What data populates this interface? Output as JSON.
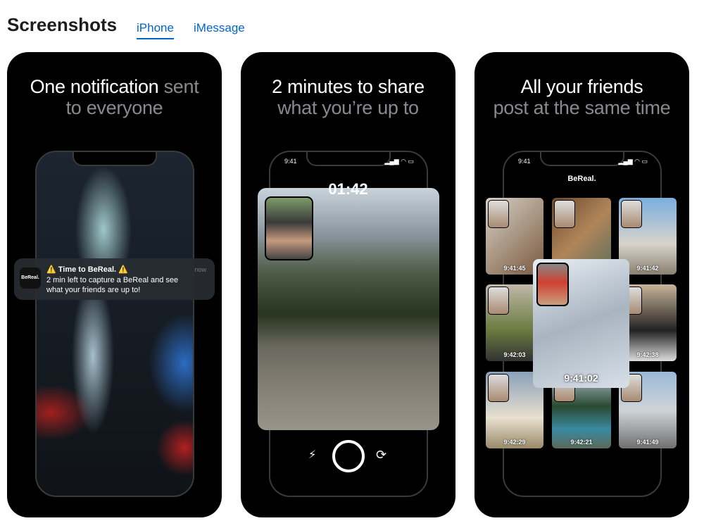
{
  "header": {
    "title": "Screenshots",
    "tabs": [
      {
        "label": "iPhone",
        "active": true
      },
      {
        "label": "iMessage",
        "active": false
      }
    ]
  },
  "cards": [
    {
      "title_white": "One notification",
      "title_gray_inline": "sent",
      "title_gray": "to everyone",
      "notification": {
        "app_icon_text": "BeReal.",
        "title": "⚠️ Time to BeReal. ⚠️",
        "time": "now",
        "body": "2 min left to capture a BeReal and see what your friends are up to!"
      }
    },
    {
      "title_white": "2 minutes to share",
      "title_gray": "what you’re up to",
      "status_time": "9:41",
      "timer": "01:42",
      "icons": [
        "flash-off-icon",
        "shutter-button",
        "flip-camera-icon"
      ]
    },
    {
      "title_white": "All your friends",
      "title_gray": "post at the same time",
      "status_time": "9:41",
      "app_title": "BeReal.",
      "tiles": [
        "9:41:45",
        "",
        "9:41:42",
        "9:42:03",
        "",
        "9:42:38",
        "9:42:29",
        "9:42:21",
        "9:41:49"
      ],
      "featured_time": "9:41:02"
    }
  ],
  "colors": {
    "accent": "#0066cc",
    "card_bg": "#000000"
  }
}
